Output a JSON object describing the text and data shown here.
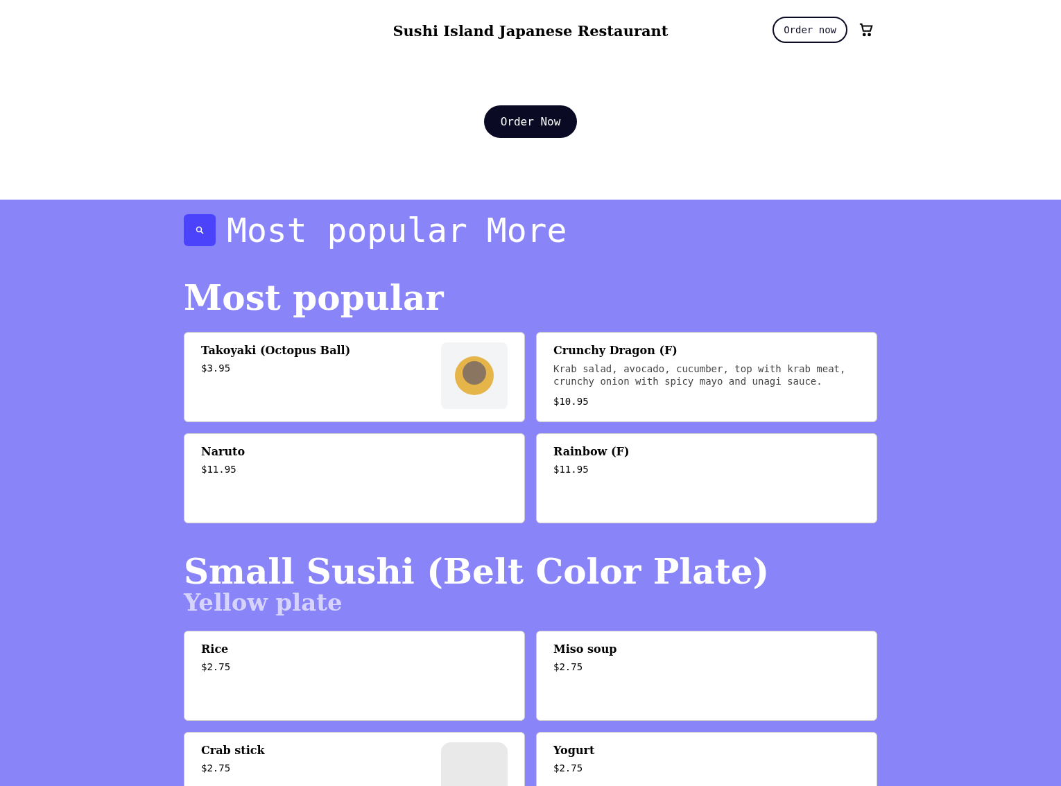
{
  "header": {
    "title": "Sushi Island Japanese Restaurant",
    "order_button": "Order now"
  },
  "hero": {
    "button": "Order Now"
  },
  "category_nav": {
    "links": [
      "Most popular",
      "More"
    ]
  },
  "sections": [
    {
      "title": "Most popular",
      "items": [
        {
          "name": "Takoyaki (Octopus Ball)",
          "price": "$3.95",
          "kind": "photo"
        },
        {
          "name": "Crunchy Dragon (F)",
          "description": "Krab salad, avocado, cucumber, top with krab meat, crunchy onion with spicy mayo and unagi sauce.",
          "price": "$10.95"
        },
        {
          "name": "Naruto",
          "price": "$11.95"
        },
        {
          "name": "Rainbow (F)",
          "price": "$11.95"
        }
      ]
    },
    {
      "title": "Small Sushi (Belt Color Plate)",
      "subtitle": "Yellow plate",
      "items": [
        {
          "name": "Rice",
          "price": "$2.75"
        },
        {
          "name": "Miso soup",
          "price": "$2.75"
        },
        {
          "name": "Crab stick",
          "price": "$2.75",
          "kind": "placeholder"
        },
        {
          "name": "Yogurt",
          "price": "$2.75"
        }
      ]
    }
  ]
}
